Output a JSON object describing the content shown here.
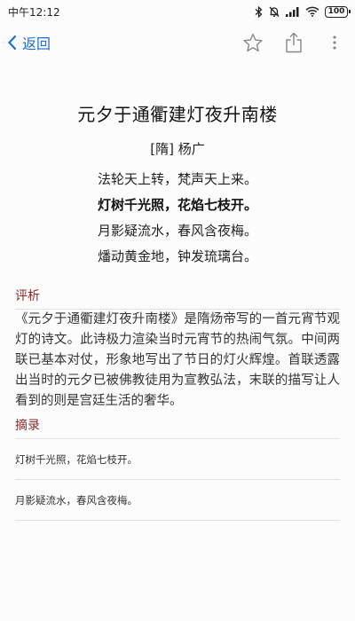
{
  "status": {
    "time": "中午12:12",
    "battery": "100"
  },
  "nav": {
    "back_label": "返回",
    "icons": [
      "chevron-left-icon",
      "star-icon",
      "share-icon",
      "more-icon"
    ],
    "accent_color": "#1f6ed0"
  },
  "poem": {
    "title": "元夕于通衢建灯夜升南楼",
    "author": "[隋] 杨广",
    "lines": [
      {
        "text": "法轮天上转，梵声天上来。",
        "bold": false
      },
      {
        "text": "灯树千光照，花焰七枝开。",
        "bold": true
      },
      {
        "text": "月影疑流水，春风含夜梅。",
        "bold": false
      },
      {
        "text": "燔动黄金地，钟发琉璃台。",
        "bold": false
      }
    ]
  },
  "commentary": {
    "title": "评析",
    "body": "《元夕于通衢建灯夜升南楼》是隋炀帝写的一首元宵节观灯的诗文。此诗极力渲染当时元宵节的热闹气氛。中间两联已基本对仗，形象地写出了节日的灯火辉煌。首联透露出当时的元夕已被佛教徒用为宣教弘法，末联的描写让人看到的则是宫廷生活的奢华。"
  },
  "excerpts": {
    "title": "摘录",
    "items": [
      "灯树千光照，花焰七枝开。",
      "月影疑流水，春风含夜梅。"
    ]
  },
  "colors": {
    "section_title": "#8b2a2a",
    "divider": "#e2e2e2"
  }
}
